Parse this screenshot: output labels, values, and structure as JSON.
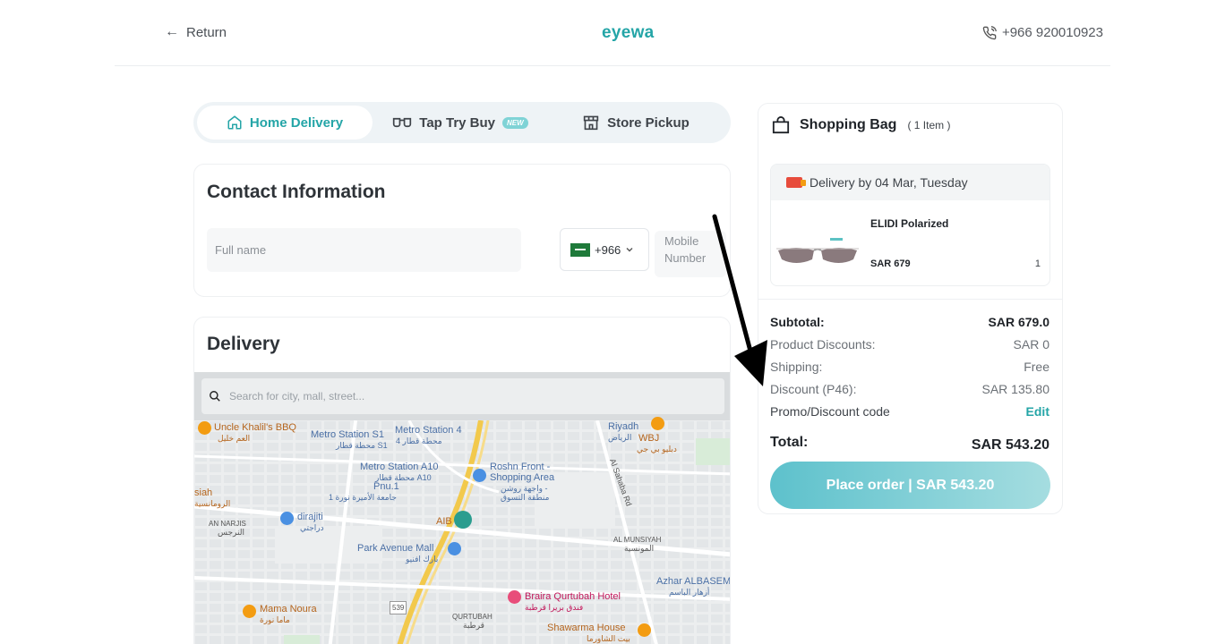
{
  "header": {
    "return_label": "Return",
    "logo": "eyewa",
    "phone": "+966 920010923"
  },
  "tabs": [
    {
      "label": "Home Delivery",
      "icon": "home-icon",
      "active": true
    },
    {
      "label": "Tap Try Buy",
      "icon": "glasses-icon",
      "badge": "NEW"
    },
    {
      "label": "Store Pickup",
      "icon": "store-icon"
    }
  ],
  "contact": {
    "title": "Contact Information",
    "fullname_placeholder": "Full name",
    "country_code": "+966",
    "mobile_placeholder": "Mobile Number"
  },
  "delivery": {
    "title": "Delivery",
    "search_placeholder": "Search for city, mall, street...",
    "map_labels": {
      "l1": "Uncle Khalil's BBQ",
      "l1ar": "العم خليل",
      "l2": "Metro Station S1",
      "l2ar": "محطة قطار S1",
      "l3": "Metro Station 4",
      "l3ar": "محطة قطار 4",
      "l4": "Riyadh",
      "l4ar": "الرياض",
      "l5": "WBJ",
      "l5ar": "دبليو بي جي",
      "l6": "Metro Station A10",
      "l6ar": "محطة قطار A10",
      "l7": "Roshn Front -",
      "l7b": "Shopping Area",
      "l7ar": "واجهة روشن -",
      "l7ar2": "منطقة التسوق",
      "l8": "Pnu.1",
      "l8ar": "جامعة الأميرة نورة 1",
      "l9": "siah",
      "l9ar": "الرومانسية",
      "l10": "AN NARJIS",
      "l10ar": "النرجس",
      "l11": "dirajiti",
      "l11ar": "دراجتي",
      "l12": "Al Sahaba Rd",
      "l13": "AL MUNSIYAH",
      "l13ar": "المونسية",
      "l14": "Park Avenue Mall",
      "l14ar": "بارك افنيو",
      "l15": "Azhar ALBASEM",
      "l15ar": "أزهار الباسم",
      "l16": "Braira Qurtubah Hotel",
      "l16ar": "فندق بريرا قرطبة",
      "l17": "Mama Noura",
      "l17ar": "ماما نورة",
      "l18": "QURTUBAH",
      "l18ar": "قرطبة",
      "l19": "Shawarma House",
      "l19ar": "بيت الشاورما",
      "l20": "539",
      "l21": "AIB"
    }
  },
  "bag": {
    "title": "Shopping Bag",
    "count": "( 1 Item )",
    "delivery_text": "Delivery by 04 Mar, Tuesday",
    "item": {
      "name": "ELIDI Polarized",
      "price": "SAR 679",
      "qty": "1"
    },
    "summary": [
      {
        "label": "Subtotal:",
        "value": "SAR 679.0"
      },
      {
        "label": "Product Discounts:",
        "value": "SAR 0"
      },
      {
        "label": "Shipping:",
        "value": "Free"
      },
      {
        "label": "Discount (P46):",
        "value": "SAR 135.80"
      },
      {
        "label": "Promo/Discount code",
        "value": "Edit"
      }
    ],
    "total_label": "Total:",
    "total_value": "SAR 543.20",
    "place_order": "Place order | SAR 543.20"
  },
  "colors": {
    "accent": "#24a5a7",
    "button_start": "#5dc1cc",
    "button_end": "#a5dde0"
  }
}
